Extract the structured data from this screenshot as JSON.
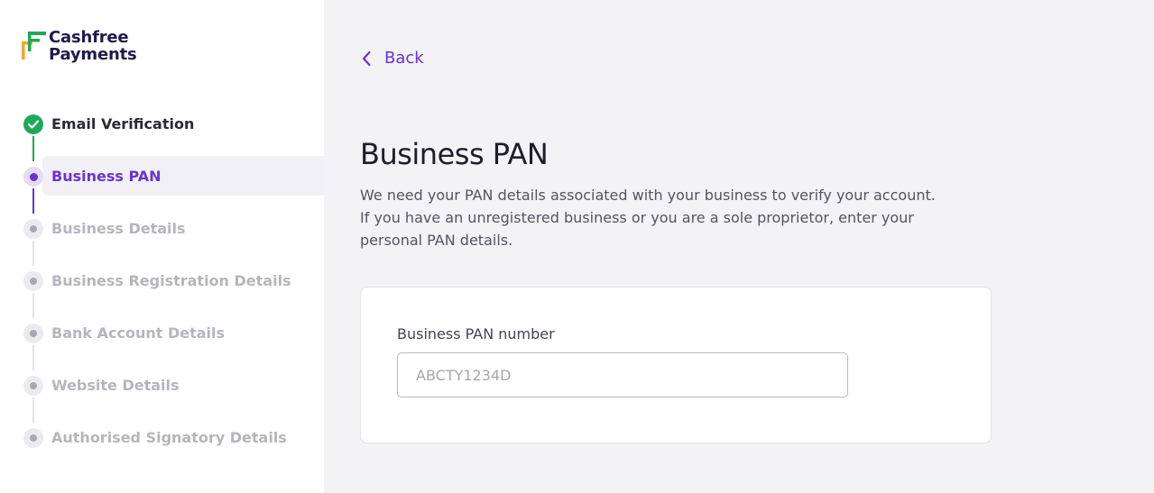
{
  "brand": {
    "line1": "Cashfree",
    "line2": "Payments"
  },
  "steps": [
    {
      "label": "Email Verification",
      "status": "done"
    },
    {
      "label": "Business PAN",
      "status": "active"
    },
    {
      "label": "Business Details",
      "status": "pending"
    },
    {
      "label": "Business Registration Details",
      "status": "pending"
    },
    {
      "label": "Bank Account Details",
      "status": "pending"
    },
    {
      "label": "Website Details",
      "status": "pending"
    },
    {
      "label": "Authorised Signatory Details",
      "status": "pending"
    }
  ],
  "main": {
    "back_label": "Back",
    "title": "Business PAN",
    "description": "We need your PAN details associated with your business to verify your account. If you have an unregistered business or you are a sole proprietor, enter your personal PAN details.",
    "field": {
      "label": "Business PAN number",
      "placeholder": "ABCTY1234D",
      "value": ""
    }
  },
  "colors": {
    "accent": "#6933d3",
    "success": "#1ea85a"
  }
}
